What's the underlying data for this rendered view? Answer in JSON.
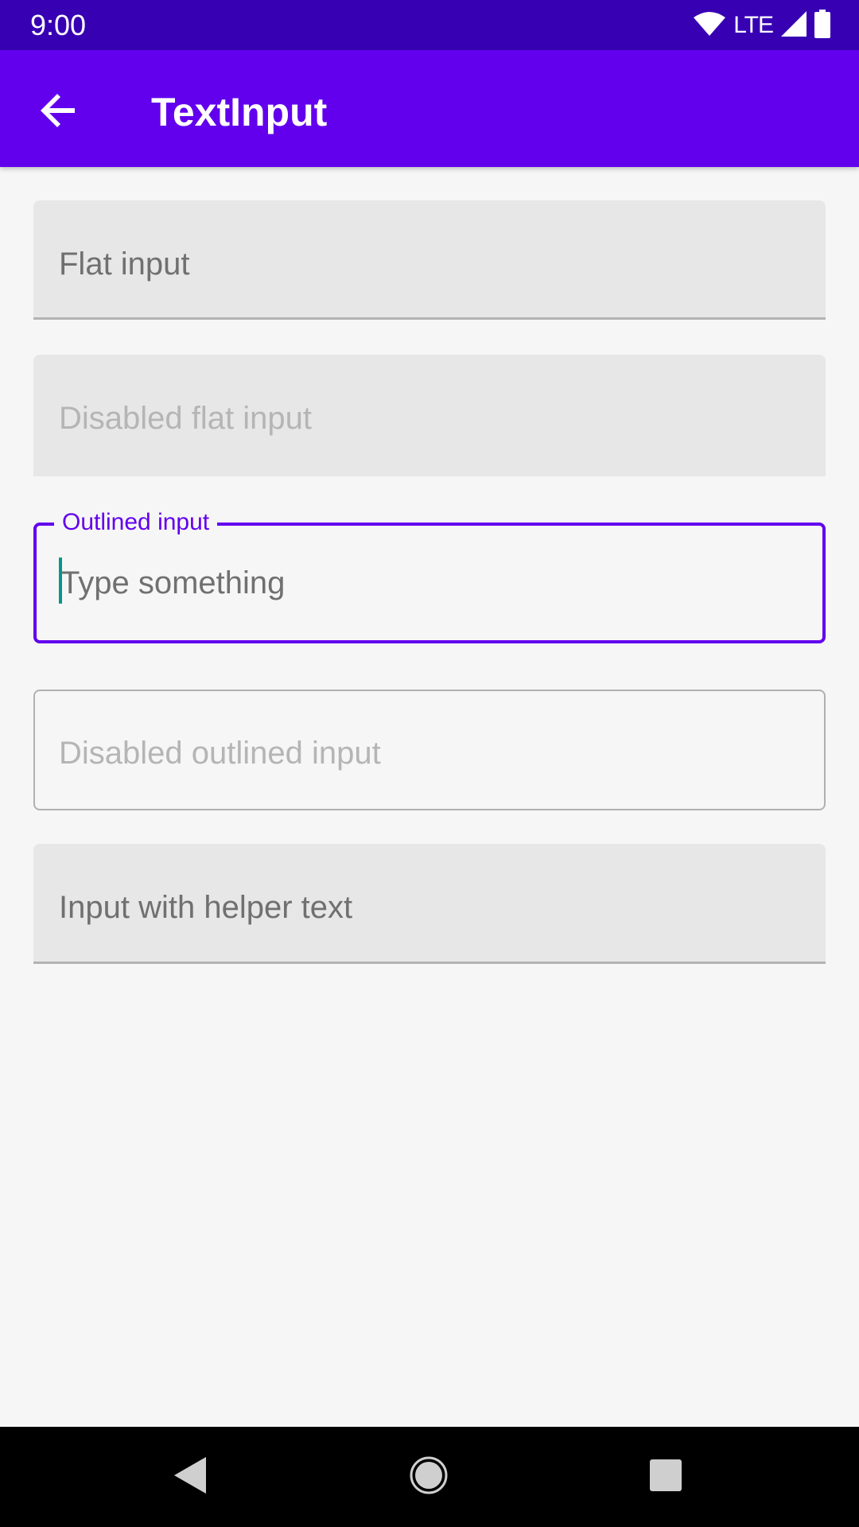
{
  "status_bar": {
    "time": "9:00",
    "network": "LTE",
    "icons": [
      "wifi-icon",
      "signal-icon",
      "battery-icon"
    ]
  },
  "app_bar": {
    "title": "TextInput",
    "back_icon": "arrow-back-icon",
    "background_color": "#6200ee"
  },
  "form": {
    "flat_input": {
      "placeholder": "Flat input"
    },
    "disabled_flat_input": {
      "placeholder": "Disabled flat input"
    },
    "outlined_input": {
      "label": "Outlined input",
      "placeholder": "Type something"
    },
    "disabled_outlined_input": {
      "placeholder": "Disabled outlined input"
    },
    "helper_input": {
      "placeholder": "Input with helper text"
    }
  },
  "nav_bar": {
    "icons": [
      "back-triangle-icon",
      "home-circle-icon",
      "recents-square-icon"
    ]
  },
  "colors": {
    "primary": "#6200ee",
    "primary_dark": "#3700b3",
    "cursor": "#03978c",
    "background": "#f6f6f6"
  }
}
